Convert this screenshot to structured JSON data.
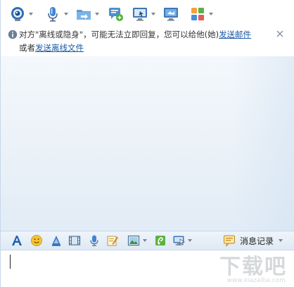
{
  "toolbar": {
    "items": [
      {
        "icon": "webcam-icon",
        "has_menu": true
      },
      {
        "icon": "microphone-icon",
        "has_menu": true
      },
      {
        "icon": "folder-transfer-icon",
        "has_menu": true
      },
      {
        "icon": "message-add-icon",
        "has_menu": false
      },
      {
        "icon": "remote-desktop-icon",
        "has_menu": true
      },
      {
        "icon": "screen-share-icon",
        "has_menu": false
      },
      {
        "icon": "apps-grid-icon",
        "has_menu": true
      }
    ]
  },
  "notice": {
    "text_before_link1": "对方\"离线或隐身\"，可能无法立即回复，您可以给他(她)",
    "link1": "发送邮件",
    "text_before_link2": "或者",
    "link2": "发送离线文件"
  },
  "bottom_toolbar": {
    "history_label": "消息记录"
  },
  "watermark": {
    "text": "下载吧",
    "url": "www.xiazaiba.com"
  },
  "colors": {
    "accent": "#1a5aa6",
    "toolbar_bg": "#e6eef7"
  }
}
